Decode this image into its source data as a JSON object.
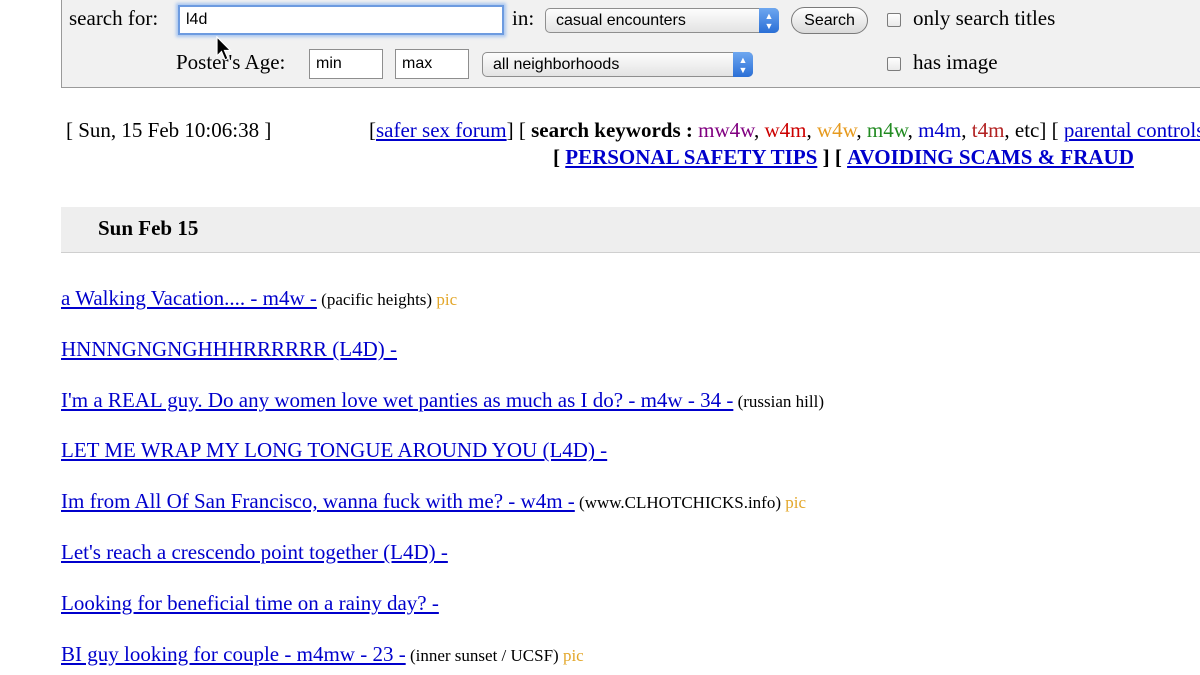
{
  "search": {
    "search_for_label": "search for:",
    "query_value": "l4d",
    "in_label": "in:",
    "category_selected": "casual encounters",
    "search_button": "Search",
    "only_titles_label": "only search titles",
    "posters_age_label": "Poster's Age:",
    "age_min_placeholder": "min",
    "age_max_placeholder": "max",
    "neighborhood_selected": "all neighborhoods",
    "has_image_label": "has image"
  },
  "header": {
    "timestamp": "[ Sun, 15 Feb 10:06:38 ]",
    "open_bracket": "[",
    "safer_sex_link": "safer sex forum",
    "close_open": "] [",
    "search_keywords_label": "search keywords :",
    "keywords": [
      {
        "text": "mw4w",
        "color": "#800080"
      },
      {
        "text": "w4m",
        "color": "#cc0000"
      },
      {
        "text": "w4w",
        "color": "#e69a1e"
      },
      {
        "text": "m4w",
        "color": "#228b22"
      },
      {
        "text": "m4m",
        "color": "#0000cc"
      },
      {
        "text": "t4m",
        "color": "#b22222"
      }
    ],
    "etc_tail": ", etc] [",
    "parent_link": "parental controls",
    "safety_tips_link": "PERSONAL SAFETY TIPS",
    "mid_bracket": "] [",
    "avoid_scams_link": "AVOIDING SCAMS & FRAUD"
  },
  "day_header": "Sun Feb 15",
  "posts": [
    {
      "title": "a Walking Vacation.... - m4w -",
      "location": "(pacific heights)",
      "pic": "pic"
    },
    {
      "title": "HNNNGNGNGHHHRRRRRR (L4D) -",
      "location": "",
      "pic": ""
    },
    {
      "title": "I'm a REAL guy. Do any women love wet panties as much as I do? - m4w - 34 -",
      "location": "(russian hill)",
      "pic": ""
    },
    {
      "title": "LET ME WRAP MY LONG TONGUE AROUND YOU (L4D) -",
      "location": "",
      "pic": ""
    },
    {
      "title": "Im from All Of San Francisco, wanna fuck with me? - w4m -",
      "location": "(www.CLHOTCHICKS.info)",
      "pic": "pic"
    },
    {
      "title": "Let's reach a crescendo point together (L4D) -",
      "location": "",
      "pic": ""
    },
    {
      "title": "Looking for beneficial time on a rainy day? -",
      "location": "",
      "pic": ""
    },
    {
      "title": "BI guy looking for couple - m4mw - 23 -",
      "location": "(inner sunset / UCSF)",
      "pic": "pic"
    }
  ]
}
